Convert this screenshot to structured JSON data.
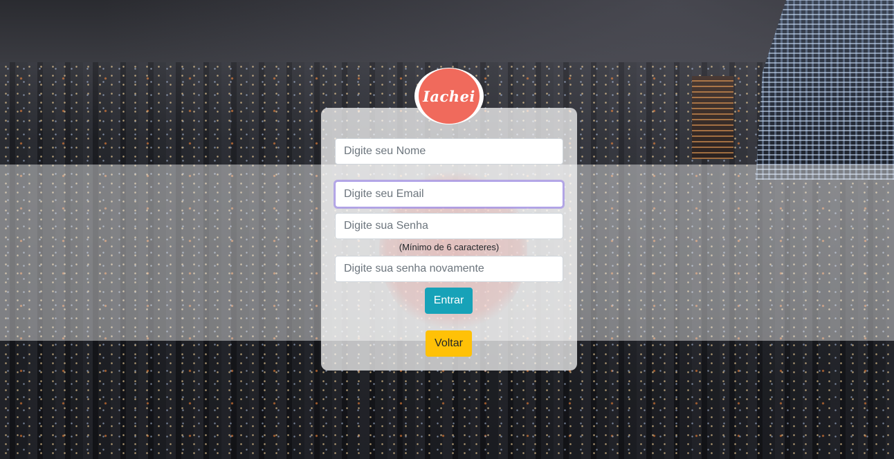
{
  "brand": {
    "logo_text": "Iachei",
    "logo_color": "#f06a5c"
  },
  "form": {
    "name_placeholder": "Digite seu Nome",
    "email_placeholder": "Digite seu Email",
    "password_placeholder": "Digite sua Senha",
    "password_hint": "(Mínimo de 6 caracteres)",
    "confirm_placeholder": "Digite sua senha novamente",
    "focused_field": "email"
  },
  "buttons": {
    "submit_label": "Entrar",
    "submit_color": "#17a2b8",
    "back_label": "Voltar",
    "back_color": "#ffc107"
  }
}
